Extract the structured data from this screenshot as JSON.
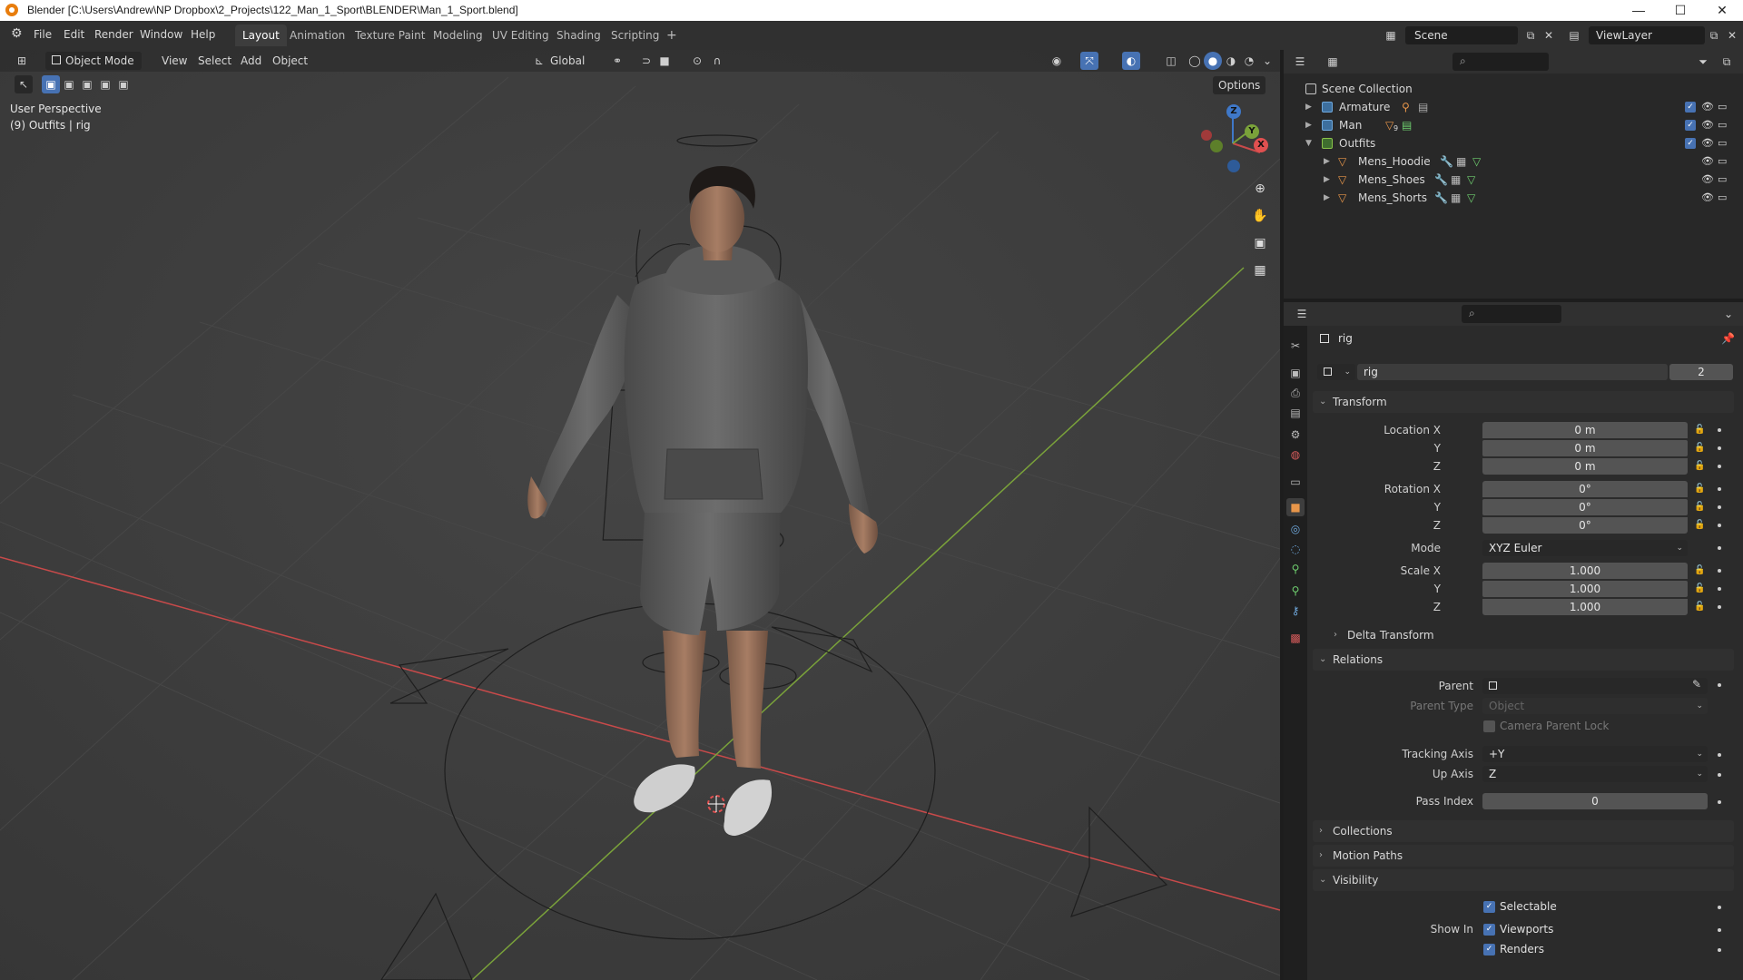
{
  "titlebar": {
    "title": "Blender [C:\\Users\\Andrew\\NP Dropbox\\2_Projects\\122_Man_1_Sport\\BLENDER\\Man_1_Sport.blend]",
    "minimize": "—",
    "maximize": "☐",
    "close": "✕"
  },
  "menus": [
    "File",
    "Edit",
    "Render",
    "Window",
    "Help"
  ],
  "workspaces": [
    "Layout",
    "Animation",
    "Texture Paint",
    "Modeling",
    "UV Editing",
    "Shading",
    "Scripting"
  ],
  "workspace_add": "+",
  "scene": {
    "name": "Scene",
    "viewlayer": "ViewLayer"
  },
  "viewport": {
    "mode": "Object Mode",
    "menus": [
      "View",
      "Select",
      "Add",
      "Object"
    ],
    "orientation": "Global",
    "options": "Options",
    "perspective": "User Perspective",
    "context": "(9) Outfits | rig",
    "gizmo": {
      "x": "X",
      "y": "Y",
      "z": "Z"
    }
  },
  "outliner": {
    "root": "Scene Collection",
    "rows": [
      {
        "label": "Armature",
        "type": "collection"
      },
      {
        "label": "Man",
        "type": "collection",
        "badge": "9"
      },
      {
        "label": "Outfits",
        "type": "collection"
      },
      {
        "label": "Mens_Hoodie",
        "type": "mesh"
      },
      {
        "label": "Mens_Shoes",
        "type": "mesh"
      },
      {
        "label": "Mens_Shorts",
        "type": "mesh"
      }
    ]
  },
  "properties": {
    "object_name": "rig",
    "datablock_name": "rig",
    "datablock_users": "2",
    "transform": {
      "header": "Transform",
      "location_label": "Location X",
      "rotation_label": "Rotation X",
      "scale_label": "Scale X",
      "y_label": "Y",
      "z_label": "Z",
      "location": [
        "0 m",
        "0 m",
        "0 m"
      ],
      "rotation": [
        "0°",
        "0°",
        "0°"
      ],
      "mode_label": "Mode",
      "mode": "XYZ Euler",
      "scale": [
        "1.000",
        "1.000",
        "1.000"
      ],
      "delta": "Delta Transform"
    },
    "relations": {
      "header": "Relations",
      "parent_label": "Parent",
      "parent_type_label": "Parent Type",
      "parent_type": "Object",
      "camera_parent_lock": "Camera Parent Lock",
      "tracking_axis_label": "Tracking Axis",
      "tracking_axis": "+Y",
      "up_axis_label": "Up Axis",
      "up_axis": "Z",
      "pass_index_label": "Pass Index",
      "pass_index": "0"
    },
    "collections": "Collections",
    "motion_paths": "Motion Paths",
    "visibility": {
      "header": "Visibility",
      "selectable": "Selectable",
      "show_in": "Show In",
      "viewports": "Viewports",
      "renders": "Renders"
    }
  },
  "colors": {
    "accent": "#4772b3",
    "x_axis": "#c84a4a",
    "y_axis": "#7aa23a",
    "z_axis": "#3f78c8"
  }
}
